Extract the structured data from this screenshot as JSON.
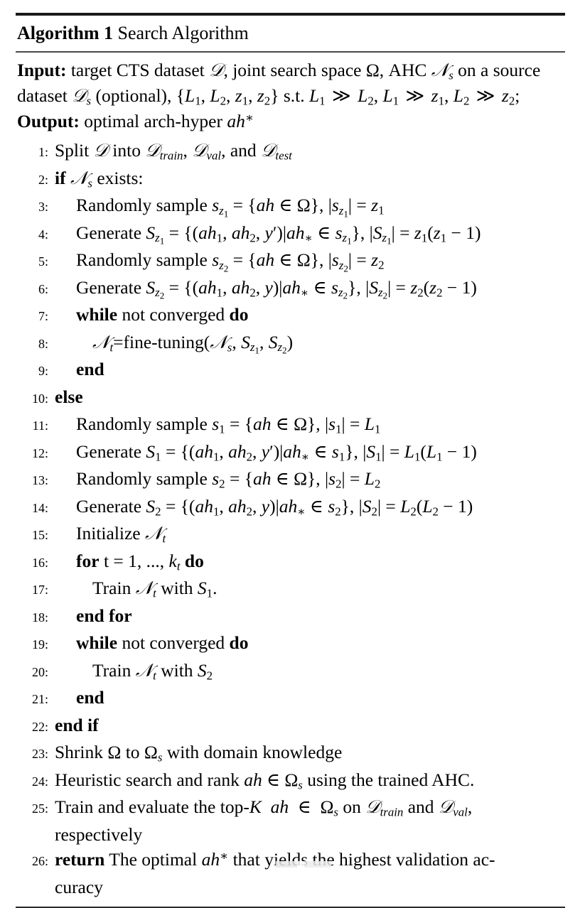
{
  "algorithm": {
    "label": "Algorithm",
    "number": "1",
    "title": "Search Algorithm",
    "header_full": "Algorithm 1 Search Algorithm"
  },
  "io": {
    "input_label": "Input:",
    "input_text": "target CTS dataset 𝒟, joint search space Ω, AHC 𝒩s on a source dataset 𝒟s (optional), {L1, L2, z1, z2} s.t. L1 ≫ L2, L1 ≫ z1, L2 ≫ z2;",
    "output_label": "Output:",
    "output_text": "optimal arch-hyper ah*"
  },
  "steps": [
    {
      "num": "1:",
      "indent": 0,
      "text": "Split 𝒟 into 𝒟train, 𝒟val, and 𝒟test"
    },
    {
      "num": "2:",
      "indent": 0,
      "text": "if 𝒩s exists:"
    },
    {
      "num": "3:",
      "indent": 1,
      "text": "Randomly sample sz1 = {ah ∈ Ω}, |sz1| = z1"
    },
    {
      "num": "4:",
      "indent": 1,
      "text": "Generate Sz1 = {(ah1, ah2, y′)|ah* ∈ sz1}, |Sz1| = z1(z1 − 1)"
    },
    {
      "num": "5:",
      "indent": 1,
      "text": "Randomly sample sz2 = {ah ∈ Ω}, |sz2| = z2"
    },
    {
      "num": "6:",
      "indent": 1,
      "text": "Generate Sz2 = {(ah1, ah2, y)|ah* ∈ sz2}, |Sz2| = z2(z2 − 1)"
    },
    {
      "num": "7:",
      "indent": 1,
      "text": "while not converged do"
    },
    {
      "num": "8:",
      "indent": 2,
      "text": "𝒩t=fine-tuning(𝒩s, Sz1, Sz2)"
    },
    {
      "num": "9:",
      "indent": 1,
      "text": "end"
    },
    {
      "num": "10:",
      "indent": 0,
      "text": "else"
    },
    {
      "num": "11:",
      "indent": 1,
      "text": "Randomly sample s1 = {ah ∈ Ω}, |s1| = L1"
    },
    {
      "num": "12:",
      "indent": 1,
      "text": "Generate S1 = {(ah1, ah2, y′)|ah* ∈ s1}, |S1| = L1(L1 − 1)"
    },
    {
      "num": "13:",
      "indent": 1,
      "text": "Randomly sample s2 = {ah ∈ Ω}, |s2| = L2"
    },
    {
      "num": "14:",
      "indent": 1,
      "text": "Generate S2 = {(ah1, ah2, y)|ah* ∈ s2}, |S2| = L2(L2 − 1)"
    },
    {
      "num": "15:",
      "indent": 1,
      "text": "Initialize 𝒩t"
    },
    {
      "num": "16:",
      "indent": 1,
      "text": "for t = 1, ..., kt do"
    },
    {
      "num": "17:",
      "indent": 2,
      "text": "Train 𝒩t with S1."
    },
    {
      "num": "18:",
      "indent": 1,
      "text": "end for"
    },
    {
      "num": "19:",
      "indent": 1,
      "text": "while not converged do"
    },
    {
      "num": "20:",
      "indent": 2,
      "text": "Train 𝒩t with S2"
    },
    {
      "num": "21:",
      "indent": 1,
      "text": "end"
    },
    {
      "num": "22:",
      "indent": 0,
      "text": "end if"
    },
    {
      "num": "23:",
      "indent": 0,
      "text": "Shrink Ω to Ωs with domain knowledge"
    },
    {
      "num": "24:",
      "indent": 0,
      "text": "Heuristic search and rank ah ∈ Ωs using the trained AHC."
    },
    {
      "num": "25:",
      "indent": 0,
      "text": "Train and evaluate the top-K ah ∈ Ωs on 𝒟train and 𝒟val, respectively"
    },
    {
      "num": "26:",
      "indent": 0,
      "text": "return The optimal ah* that yields the highest validation accuracy"
    }
  ],
  "continuations": {
    "line25": "respectively",
    "line26": "curacy"
  }
}
